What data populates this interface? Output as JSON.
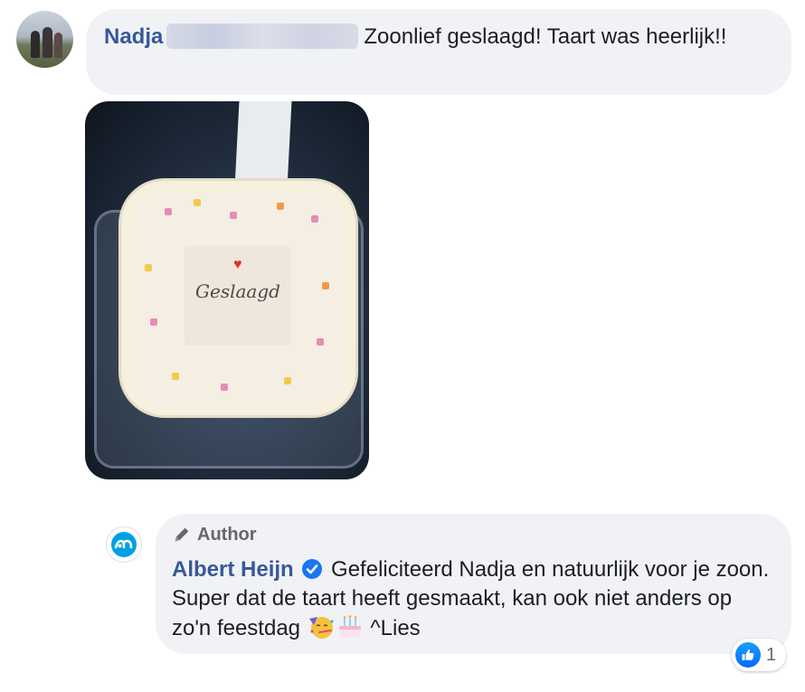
{
  "comment": {
    "author": "Nadja",
    "text": "Zoonlief geslaagd! Taart was heerlijk!!",
    "photo_caption": "Geslaagd"
  },
  "reply": {
    "badge": "Author",
    "author": "Albert Heijn",
    "text": "Gefeliciteerd Nadja en natuurlijk voor je zoon. Super dat de taart heeft gesmaakt, kan ook niet anders op zo'n feestdag",
    "emojis": [
      "partying-face",
      "birthday-cake"
    ],
    "signature": "^Lies"
  },
  "reactions": {
    "type": "like",
    "count": "1"
  },
  "colors": {
    "link": "#385898",
    "bubble": "#f0f2f5",
    "verified": "#1877f2",
    "ah_blue": "#00a0e2"
  }
}
